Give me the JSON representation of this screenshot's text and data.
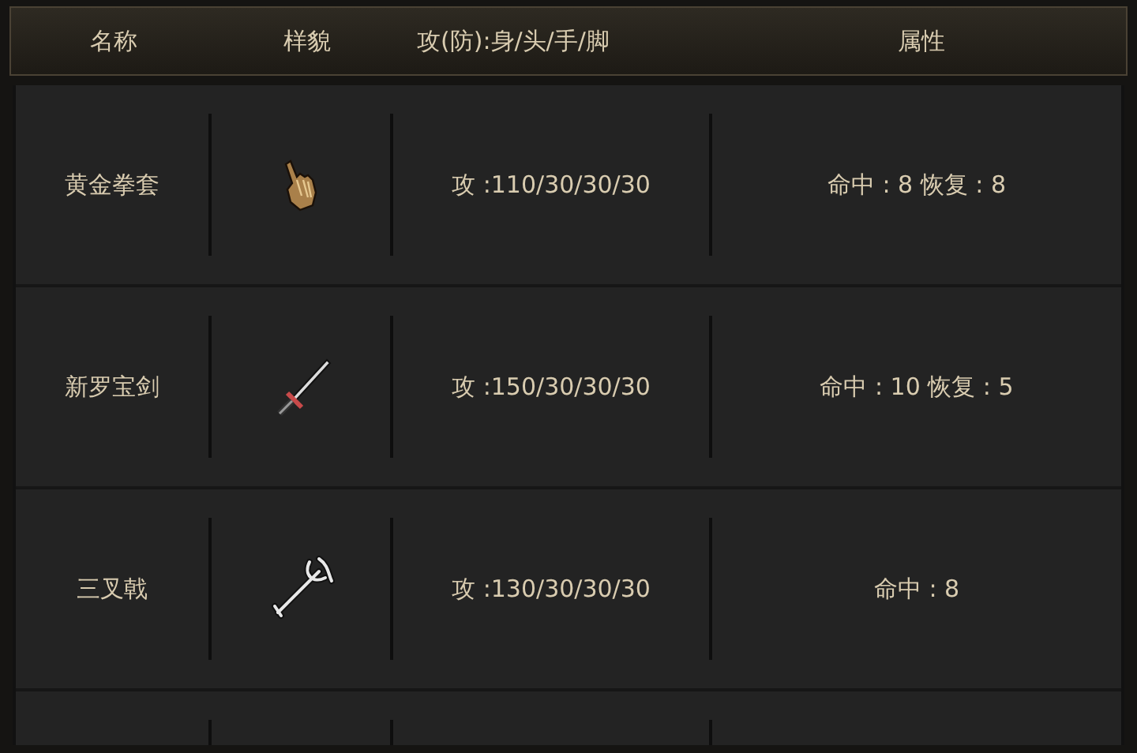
{
  "table": {
    "columns": [
      "名称",
      "样貌",
      "攻(防):身/头/手/脚",
      "属性"
    ],
    "rows": [
      {
        "name": "黄金拳套",
        "kind": "glove",
        "stats": "攻 :110/30/30/30",
        "attributes": "命中 : 8 恢复 : 8"
      },
      {
        "name": "新罗宝剑",
        "kind": "sword",
        "stats": "攻 :150/30/30/30",
        "attributes": "命中 : 10 恢复 : 5"
      },
      {
        "name": "三叉戟",
        "kind": "trident",
        "stats": "攻 :130/30/30/30",
        "attributes": "命中 : 8"
      }
    ]
  }
}
